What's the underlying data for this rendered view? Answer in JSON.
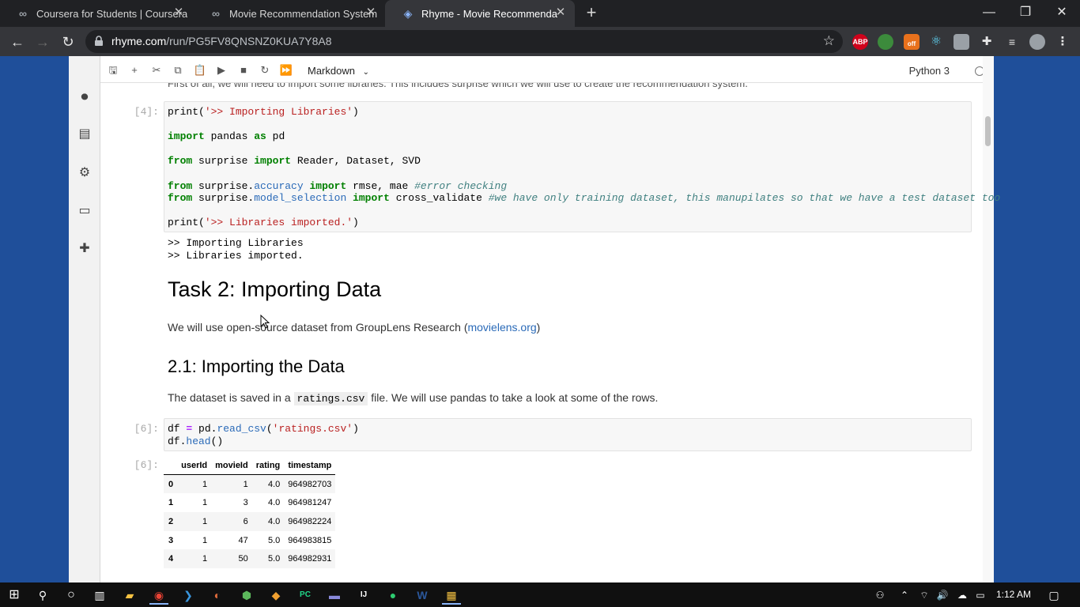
{
  "browser": {
    "tabs": [
      {
        "title": "Coursera for Students | Coursera",
        "icon": "coursera-icon",
        "active": false
      },
      {
        "title": "Movie Recommendation System",
        "icon": "coursera-icon",
        "active": false
      },
      {
        "title": "Rhyme - Movie Recommendation",
        "icon": "rhyme-icon",
        "active": true
      }
    ],
    "new_tab": "+",
    "url_host": "rhyme.com",
    "url_path": "/run/PG5FV8QNSNZ0KUA7Y8A8",
    "extensions": [
      {
        "name": "adblock-icon",
        "label": "ABP",
        "color": "#d0021b"
      },
      {
        "name": "extension-icon",
        "label": "",
        "color": "#3c8b3c"
      },
      {
        "name": "off-badge-icon",
        "label": "off",
        "color": "#e8711c"
      },
      {
        "name": "react-devtools-icon",
        "label": "",
        "color": "#61dafb"
      },
      {
        "name": "camera-icon",
        "label": "",
        "color": "#9aa0a6"
      },
      {
        "name": "puzzle-icon",
        "label": "",
        "color": "#e6e6e6"
      },
      {
        "name": "media-control-icon",
        "label": "",
        "color": "#e6e6e6"
      },
      {
        "name": "profile-avatar-icon",
        "label": "",
        "color": "#9aa0a6"
      }
    ]
  },
  "notebook": {
    "celltype": "Markdown",
    "kernel": "Python 3",
    "prev_text": "First of all, we will need to import some libraries. This includes surprise which we will use to create the recommendation system.",
    "cell4": {
      "prompt": "[4]:",
      "output": ">> Importing Libraries\n>> Libraries imported."
    },
    "task2": {
      "heading": "Task 2: Importing Data",
      "para_before": "We will use open-source dataset from GroupLens Research (",
      "link": "movielens.org",
      "para_after": ")"
    },
    "sub21": {
      "heading": "2.1: Importing the Data",
      "para_before": "The dataset is saved in a",
      "code": "ratings.csv",
      "para_after": "file. We will use pandas to take a look at some of the rows."
    },
    "cell6": {
      "prompt": "[6]:",
      "out_prompt": "[6]:"
    },
    "table": {
      "columns": [
        "",
        "userId",
        "movieId",
        "rating",
        "timestamp"
      ],
      "rows": [
        [
          "0",
          "1",
          "1",
          "4.0",
          "964982703"
        ],
        [
          "1",
          "1",
          "3",
          "4.0",
          "964981247"
        ],
        [
          "2",
          "1",
          "6",
          "4.0",
          "964982224"
        ],
        [
          "3",
          "1",
          "47",
          "5.0",
          "964983815"
        ],
        [
          "4",
          "1",
          "50",
          "5.0",
          "964982931"
        ]
      ]
    }
  },
  "taskbar": {
    "time": "1:12 AM"
  }
}
